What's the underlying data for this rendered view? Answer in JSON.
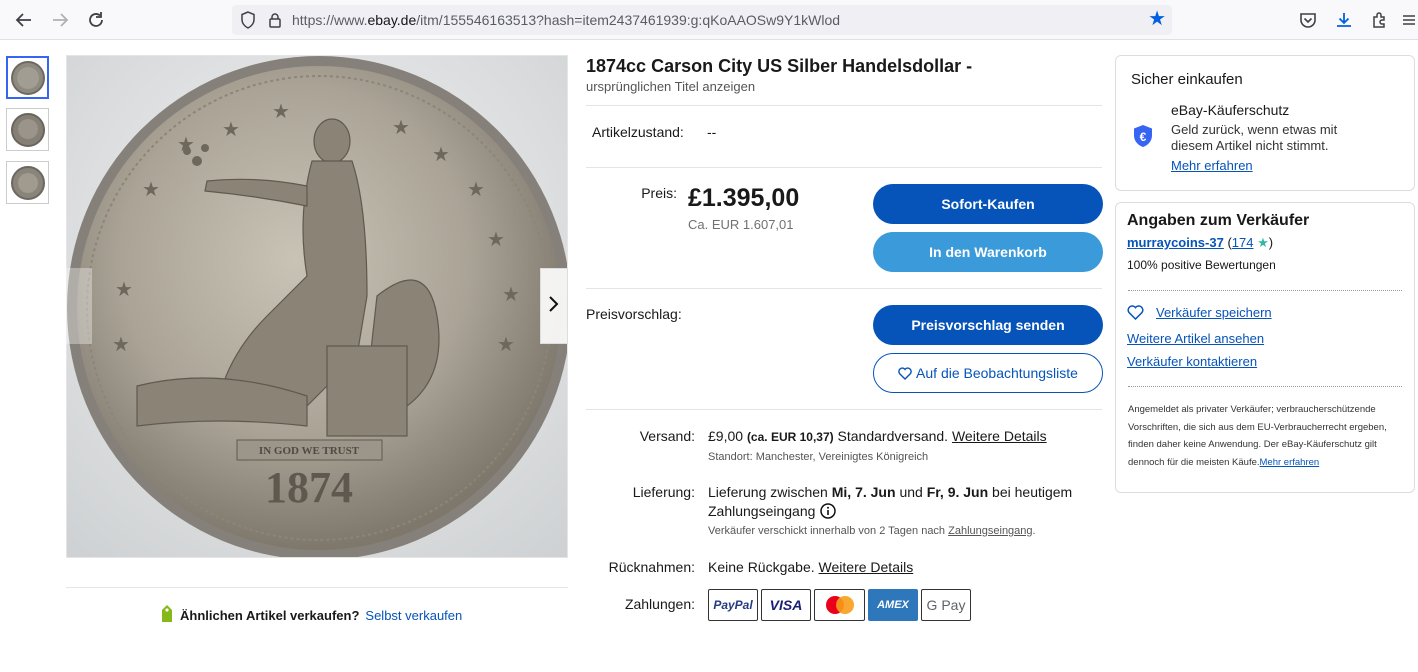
{
  "browser": {
    "url_prefix": "https://www.",
    "url_host": "ebay.de",
    "url_rest": "/itm/155546163513?hash=item2437461939:g:qKoAAOSw9Y1kWlod"
  },
  "listing": {
    "title": "1874cc Carson City US Silber Handelsdollar -",
    "original_title_link": "ursprünglichen Titel anzeigen",
    "condition_label": "Artikelzustand:",
    "condition_value": "--",
    "price_label": "Preis:",
    "price": "£1.395,00",
    "price_converted": "Ca. EUR 1.607,01",
    "buy_now": "Sofort-Kaufen",
    "add_to_cart": "In den Warenkorb",
    "offer_label": "Preisvorschlag:",
    "send_offer": "Preisvorschlag senden",
    "watchlist": "Auf die Beobachtungsliste",
    "shipping_label": "Versand:",
    "shipping_price": "£9,00",
    "shipping_converted": "(ca. EUR 10,37)",
    "shipping_method": "Standardversand.",
    "shipping_details_link": "Weitere Details",
    "location": "Standort: Manchester, Vereinigtes Königreich",
    "delivery_label": "Lieferung:",
    "delivery_pre": "Lieferung zwischen",
    "delivery_from": "Mi, 7. Jun",
    "delivery_and": "und",
    "delivery_to": "Fr, 9. Jun",
    "delivery_post": "bei heutigem",
    "delivery_line2": "Zahlungseingang",
    "dispatch_pre": "Verkäufer verschickt innerhalb von 2 Tagen nach",
    "dispatch_link": "Zahlungseingang",
    "dispatch_post": ".",
    "returns_label": "Rücknahmen:",
    "returns_value": "Keine Rückgabe.",
    "returns_details_link": "Weitere Details",
    "payments_label": "Zahlungen:",
    "payments": [
      "PayPal",
      "VISA",
      "Mastercard",
      "AMEX",
      "G Pay"
    ]
  },
  "sell_similar": {
    "question": "Ähnlichen Artikel verkaufen?",
    "link": "Selbst verkaufen"
  },
  "protection": {
    "heading": "Sicher einkaufen",
    "title": "eBay-Käuferschutz",
    "line1": "Geld zurück, wenn etwas mit",
    "line2": "diesem Artikel nicht stimmt.",
    "link": "Mehr erfahren"
  },
  "seller": {
    "heading": "Angaben zum Verkäufer",
    "name": "murraycoins-37",
    "feedback_open": "(",
    "feedback_count": "174",
    "feedback_close": ")",
    "positive": "100% positive Bewertungen",
    "save": "Verkäufer speichern",
    "more_items": "Weitere Artikel ansehen",
    "contact": "Verkäufer kontaktieren",
    "fine_print": "Angemeldet als privater Verkäufer; verbraucherschützende Vorschriften, die sich aus dem EU-Verbraucherrecht ergeben, finden daher keine Anwendung. Der eBay-Käuferschutz gilt dennoch für die meisten Käufe.",
    "fine_print_link": "Mehr erfahren"
  },
  "coin": {
    "motto": "IN GOD WE TRUST",
    "year": "1874"
  },
  "colors": {
    "primary_blue": "#0654ba",
    "secondary_blue": "#3b9ad9",
    "star_teal": "#36b5a2"
  }
}
